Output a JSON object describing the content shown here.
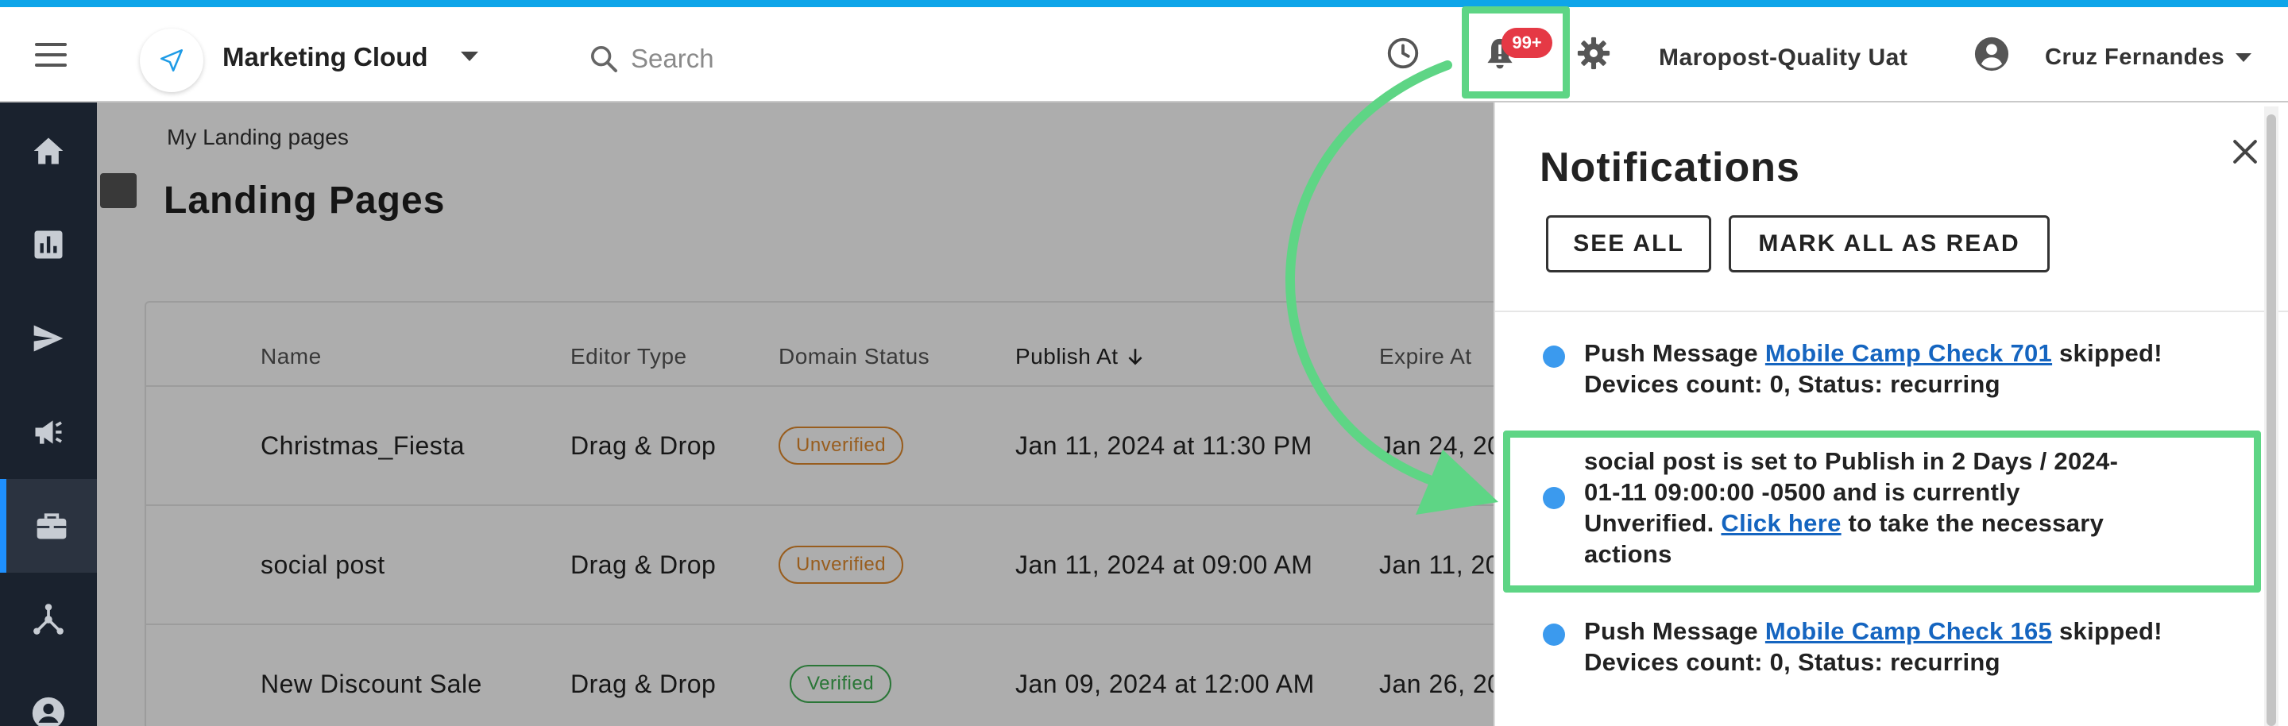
{
  "colors": {
    "accent_top": "#0ea5e9",
    "sidebar_bg": "#1a222e",
    "sidebar_active_border": "#1e90ff",
    "badge": "#e53945",
    "highlight": "#5ed585",
    "link": "#1565c0",
    "unread_dot": "#3b9aee",
    "status_unverified": "#e08a2d",
    "status_verified": "#3fae52"
  },
  "header": {
    "app_name": "Marketing Cloud",
    "search_placeholder": "Search",
    "notification_badge": "99+",
    "org_name": "Maropost-Quality Uat",
    "user_name": "Cruz Fernandes",
    "icons": [
      "menu-icon",
      "send-icon",
      "search-icon",
      "history-icon",
      "bell-alert-icon",
      "gear-icon",
      "account-circle-icon"
    ]
  },
  "sidebar": {
    "items": [
      {
        "name": "home",
        "icon": "home-icon",
        "active": false
      },
      {
        "name": "reports",
        "icon": "bar-chart-icon",
        "active": false
      },
      {
        "name": "campaigns",
        "icon": "send-icon",
        "active": false
      },
      {
        "name": "announcements",
        "icon": "megaphone-icon",
        "active": false
      },
      {
        "name": "toolkit",
        "icon": "briefcase-icon",
        "active": true
      },
      {
        "name": "journeys",
        "icon": "hierarchy-icon",
        "active": false
      },
      {
        "name": "contacts",
        "icon": "account-icon",
        "active": false
      }
    ]
  },
  "main": {
    "breadcrumb": "My Landing pages",
    "title": "Landing Pages",
    "table": {
      "columns": [
        "Name",
        "Editor Type",
        "Domain Status",
        "Publish At",
        "Expire At"
      ],
      "rows": [
        {
          "name": "Christmas_Fiesta",
          "editor": "Drag & Drop",
          "status": "Unverified",
          "publish_at": "Jan 11, 2024 at 11:30 PM",
          "expire_at": "Jan 24, 20"
        },
        {
          "name": "social post",
          "editor": "Drag & Drop",
          "status": "Unverified",
          "publish_at": "Jan 11, 2024 at 09:00 AM",
          "expire_at": "Jan 11, 20"
        },
        {
          "name": "New Discount Sale",
          "editor": "Drag & Drop",
          "status": "Verified",
          "publish_at": "Jan 09, 2024 at 12:00 AM",
          "expire_at": "Jan 26, 20"
        }
      ]
    }
  },
  "notifications": {
    "title": "Notifications",
    "see_all": "SEE ALL",
    "mark_all_read": "MARK ALL AS READ",
    "items": [
      {
        "prefix": "Push Message ",
        "link": "Mobile Camp Check 701",
        "suffix_line1": " skipped!",
        "line2": "Devices count: 0, Status: recurring"
      },
      {
        "line1": "social post is set to Publish in 2 Days / 2024-",
        "line2": "01-11 09:00:00 -0500 and is currently",
        "line3_prefix": "Unverified. ",
        "link": "Click here",
        "line3_suffix": " to take the necessary",
        "line4": "actions"
      },
      {
        "prefix": "Push Message ",
        "link": "Mobile Camp Check 165",
        "suffix_line1": " skipped!",
        "line2": "Devices count: 0, Status: recurring"
      }
    ]
  }
}
